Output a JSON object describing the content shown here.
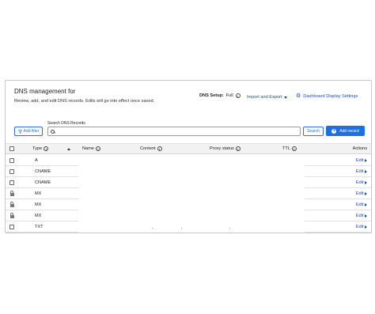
{
  "header": {
    "title": "DNS management for",
    "description": "Review, add, and edit DNS records. Edits will go into effect once saved.",
    "setup_label": "DNS Setup:",
    "setup_value": "Full",
    "import_label": "Import and Export",
    "dashboard_settings_label": "Dashboard Display Settings"
  },
  "toolbar": {
    "filter_label": "Add filter",
    "search_label": "Search DNS Records",
    "search_value": "",
    "search_placeholder": "",
    "search_button_label": "Search",
    "add_record_label": "Add record"
  },
  "table": {
    "columns": [
      "Type",
      "Name",
      "Content",
      "Proxy status",
      "TTL",
      "Actions"
    ],
    "rows": [
      {
        "type": "A",
        "locked": false,
        "action": "Edit"
      },
      {
        "type": "CNAME",
        "locked": false,
        "action": "Edit"
      },
      {
        "type": "CNAME",
        "locked": false,
        "action": "Edit"
      },
      {
        "type": "MX",
        "locked": true,
        "action": "Edit"
      },
      {
        "type": "MX",
        "locked": true,
        "action": "Edit"
      },
      {
        "type": "MX",
        "locked": true,
        "action": "Edit"
      },
      {
        "type": "TXT",
        "locked": false,
        "action": "Edit"
      }
    ]
  },
  "colors": {
    "accent": "#1f6fe0",
    "link": "#1f4fa8"
  }
}
